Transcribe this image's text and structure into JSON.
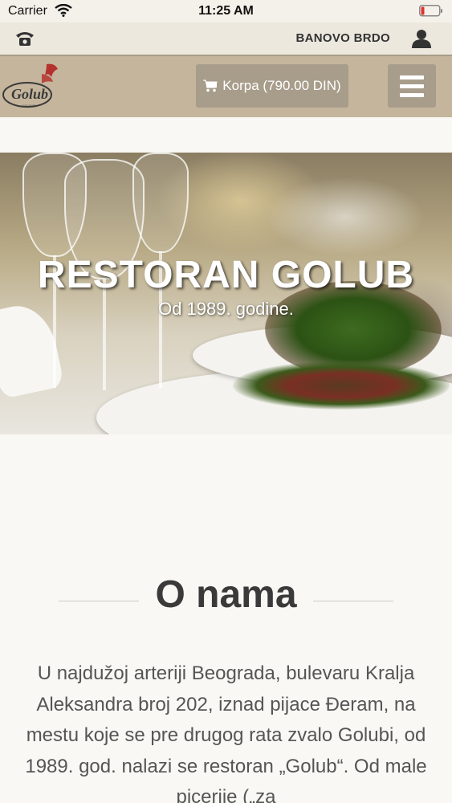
{
  "status_bar": {
    "carrier": "Carrier",
    "time": "11:25 AM"
  },
  "info_bar": {
    "location": "BANOVO BRDO",
    "phone_icon": "phone-icon",
    "user_icon": "user-icon"
  },
  "header": {
    "logo_text": "Golub",
    "cart_label": "Korpa (790.00 DIN)",
    "cart_icon": "cart-icon",
    "menu_icon": "hamburger-icon"
  },
  "hero": {
    "title": "RESTORAN GOLUB",
    "subtitle": "Od 1989. godine."
  },
  "about": {
    "title": "O nama",
    "text": "U najdužoj arteriji Beograda, bulevaru Kralja Aleksandra broj 202, iznad pijace Đeram, na mestu koje se pre drugog rata zvalo Golubi, od 1989. god. nalazi se restoran „Golub“. Od male picerije („za"
  },
  "colors": {
    "header_bg": "#c4b59c",
    "button_bg": "#a89d8b",
    "info_bar_bg": "#ece8de",
    "page_bg": "#faf8f4"
  }
}
